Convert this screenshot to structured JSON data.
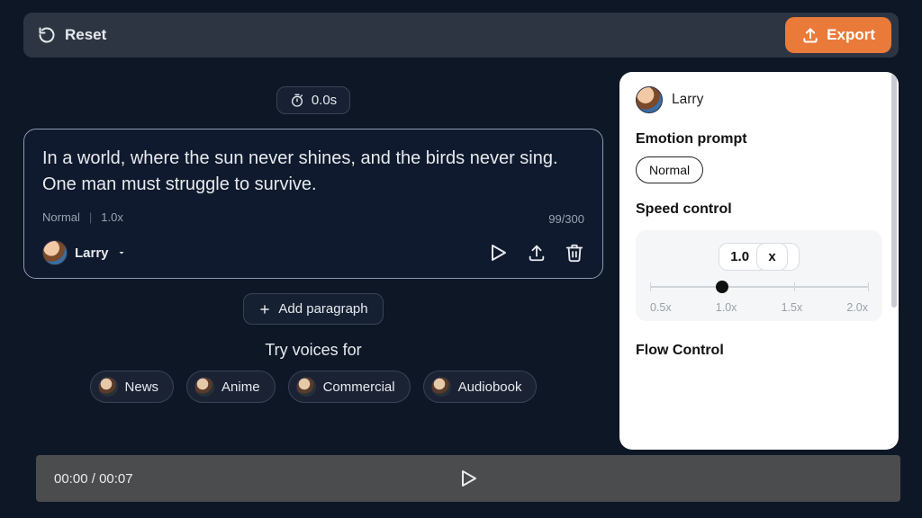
{
  "topbar": {
    "reset_label": "Reset",
    "export_label": "Export"
  },
  "duration_pill": "0.0s",
  "editor": {
    "text": "In a world, where the sun never shines, and the birds never sing. One man must struggle to survive.",
    "emotion": "Normal",
    "speed": "1.0x",
    "char_count": "99/300",
    "voice_name": "Larry"
  },
  "add_paragraph_label": "Add paragraph",
  "try_voices_title": "Try voices for",
  "voice_chips": [
    {
      "label": "News"
    },
    {
      "label": "Anime"
    },
    {
      "label": "Commercial"
    },
    {
      "label": "Audiobook"
    }
  ],
  "right_panel": {
    "voice_name": "Larry",
    "emotion_title": "Emotion prompt",
    "emotion_value": "Normal",
    "speed_title": "Speed control",
    "speed_value_label": "1.0",
    "speed_unit": "x",
    "speed_ticks": [
      "0.5x",
      "1.0x",
      "1.5x",
      "2.0x"
    ],
    "speed_position_pct": 33,
    "flow_title": "Flow Control"
  },
  "playbar": {
    "current": "00:00",
    "total": "00:07"
  }
}
